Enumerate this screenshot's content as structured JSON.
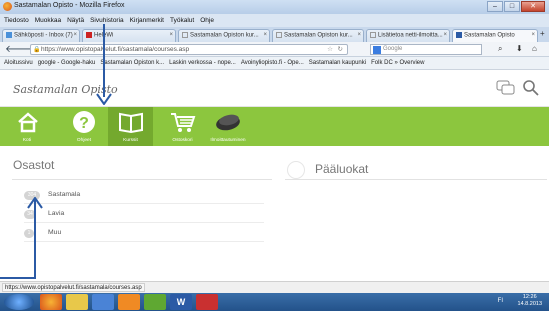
{
  "window": {
    "title": "Sastamalan Opisto - Mozilla Firefox",
    "controls": [
      "–",
      "□",
      "✕"
    ]
  },
  "menu": [
    "Tiedosto",
    "Muokkaa",
    "Näytä",
    "Sivuhistoria",
    "Kirjanmerkit",
    "Työkalut",
    "Ohje"
  ],
  "tabs": [
    {
      "label": "Sähköposti - Inbox (7)",
      "active": false
    },
    {
      "label": "HeleWi",
      "active": false
    },
    {
      "label": "Sastamalan Opiston kur...",
      "active": false
    },
    {
      "label": "Sastamalan Opiston kur...",
      "active": false
    },
    {
      "label": "Lisätietoa netti-ilmoitta...",
      "active": false
    },
    {
      "label": "Sastamalan Opisto",
      "active": true
    }
  ],
  "nav": {
    "url": "https://www.opistopalvelut.fi/sastamala/courses.asp",
    "search_placeholder": "Google"
  },
  "bookmarks": [
    "Aloitussivu",
    "google - Google-haku",
    "Sastamalan Opiston k...",
    "Laskin verkossa - nope...",
    "Avoinyliopisto.fi - Ope...",
    "Sastamalan kaupunki",
    "Folk DC » Overview"
  ],
  "site": {
    "title": "Sastamalan Opisto",
    "nav_items": [
      {
        "label": "Koti",
        "icon": "home-icon",
        "selected": false
      },
      {
        "label": "Ohjeet",
        "icon": "help-icon",
        "selected": false
      },
      {
        "label": "Kurssit",
        "icon": "book-icon",
        "selected": true
      },
      {
        "label": "Ostoskori",
        "icon": "cart-icon",
        "selected": false
      },
      {
        "label": "Ilmoittautuminen",
        "icon": "registration-icon",
        "selected": false
      }
    ]
  },
  "main": {
    "left_heading": "Osastot",
    "right_heading": "Pääluokat",
    "departments": [
      {
        "name": "Sastamala",
        "count": "304"
      },
      {
        "name": "Lavia",
        "count": "34"
      },
      {
        "name": "Muu",
        "count": "1"
      }
    ]
  },
  "status": {
    "url": "https://www.opistopalvelut.fi/sastamala/courses.asp"
  },
  "taskbar": {
    "time": "12:26",
    "date": "14.8.2013",
    "tray": "FI"
  },
  "colors": {
    "green_bar": "#8cc63e",
    "green_selected": "#74a92e",
    "annotation_arrow": "#2b5aa5"
  }
}
